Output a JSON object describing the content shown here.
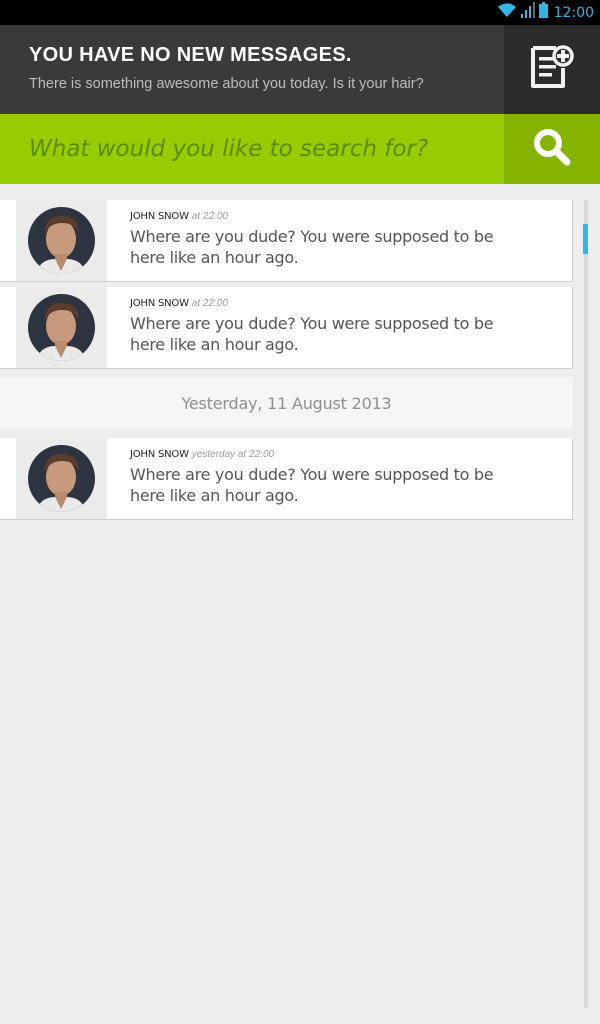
{
  "status_bar": {
    "time": "12:00",
    "icons": [
      "wifi-icon",
      "signal-icon",
      "battery-icon"
    ],
    "accent_color": "#33b5e5"
  },
  "header": {
    "title": "YOU HAVE NO NEW MESSAGES.",
    "subtitle": "There is something awesome about you today. Is it your hair?",
    "compose_icon": "compose-note-icon",
    "background": "#3a3a3a"
  },
  "search": {
    "placeholder": "What would you like to search for?",
    "value": "",
    "button_icon": "search-icon",
    "accent_color": "#99cc00"
  },
  "messages": [
    {
      "sender": "JOHN SNOW",
      "time": "at 22:00",
      "text": "Where are you dude? You were supposed to be here like an hour ago.",
      "avatar": "avatar-john-snow"
    },
    {
      "sender": "JOHN SNOW",
      "time": "at 22:00",
      "text": "Where are you dude? You were supposed to be here like an hour ago.",
      "avatar": "avatar-john-snow"
    },
    {
      "sender": "JOHN SNOW",
      "time": "yesterday at 22:00",
      "text": "Where are you dude? You were supposed to be here like an hour ago.",
      "avatar": "avatar-john-snow"
    }
  ],
  "date_separator": "Yesterday, 11 August 2013"
}
